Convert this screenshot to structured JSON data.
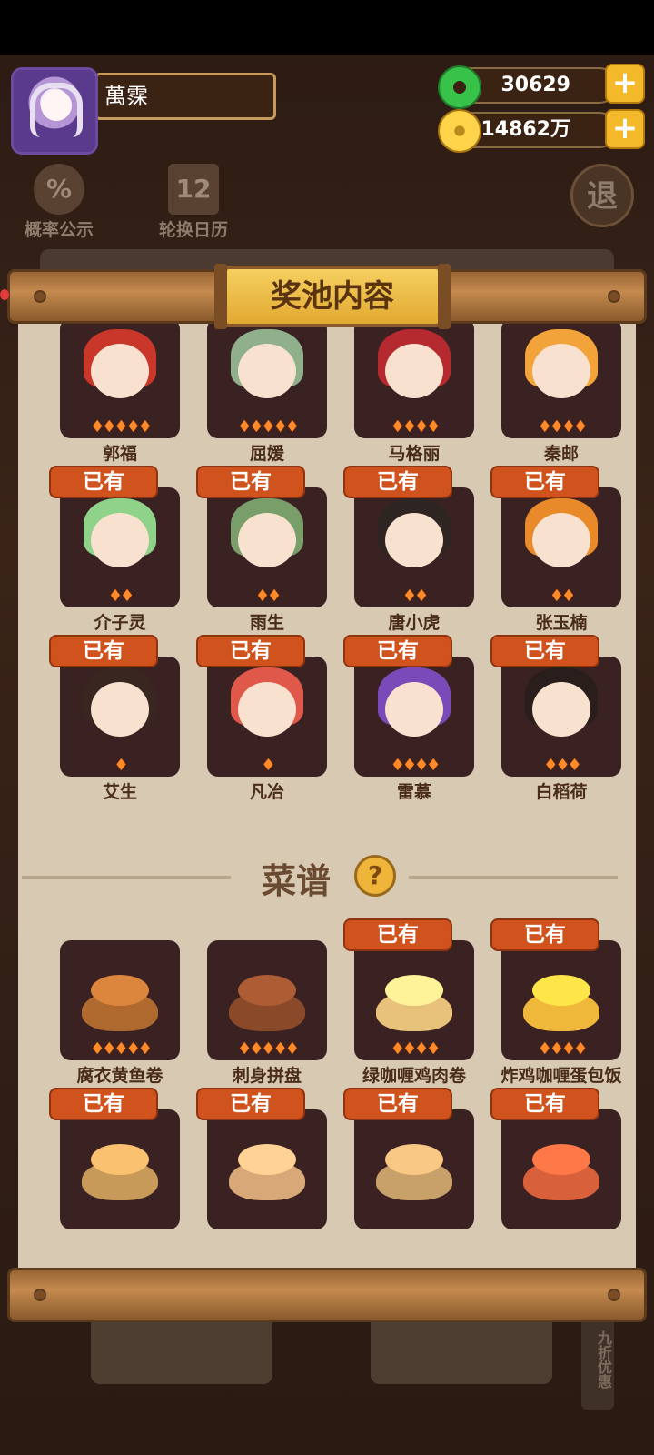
{
  "player": {
    "name": "萬霂"
  },
  "resources": {
    "jade": "30629",
    "coins": "14862万"
  },
  "background": {
    "probability_label": "概率公示",
    "calendar_label": "轮换日历",
    "exit_label": "退",
    "discount_label": "九折优惠"
  },
  "panel": {
    "title": "奖池内容"
  },
  "owned_label": "已有",
  "characters": [
    {
      "name": "郭福",
      "owned": false,
      "stars": "♦♦♦♦♦",
      "hair": "#c8372a"
    },
    {
      "name": "屈媛",
      "owned": false,
      "stars": "♦♦♦♦♦",
      "hair": "#8fb08a"
    },
    {
      "name": "马格丽",
      "owned": false,
      "stars": "♦♦♦♦",
      "hair": "#b52a2e"
    },
    {
      "name": "秦邮",
      "owned": false,
      "stars": "♦♦♦♦",
      "hair": "#f2a33a"
    },
    {
      "name": "介子灵",
      "owned": true,
      "stars": "♦♦",
      "hair": "#8fd28a"
    },
    {
      "name": "雨生",
      "owned": true,
      "stars": "♦♦",
      "hair": "#7a9e6a"
    },
    {
      "name": "唐小虎",
      "owned": true,
      "stars": "♦♦",
      "hair": "#2e2422"
    },
    {
      "name": "张玉楠",
      "owned": true,
      "stars": "♦♦",
      "hair": "#e88a2a"
    },
    {
      "name": "艾生",
      "owned": true,
      "stars": "♦",
      "hair": "#3a2620"
    },
    {
      "name": "凡冶",
      "owned": true,
      "stars": "♦",
      "hair": "#e0584a"
    },
    {
      "name": "雷慕",
      "owned": true,
      "stars": "♦♦♦♦",
      "hair": "#7a4ab8"
    },
    {
      "name": "白稻荷",
      "owned": true,
      "stars": "♦♦♦",
      "hair": "#2a1e1c"
    }
  ],
  "recipes_section": {
    "title": "菜谱",
    "help_icon": "?"
  },
  "recipes": [
    {
      "name": "腐衣黄鱼卷",
      "owned": false,
      "stars": "♦♦♦♦♦",
      "color": "#b06a30"
    },
    {
      "name": "刺身拼盘",
      "owned": false,
      "stars": "♦♦♦♦♦",
      "color": "#8a4a2a"
    },
    {
      "name": "绿咖喱鸡肉卷",
      "owned": true,
      "stars": "♦♦♦♦",
      "color": "#e8c27a"
    },
    {
      "name": "炸鸡咖喱蛋包饭",
      "owned": true,
      "stars": "♦♦♦♦",
      "color": "#f0b83a"
    },
    {
      "name": "",
      "owned": true,
      "stars": "",
      "color": "#c89a5a"
    },
    {
      "name": "",
      "owned": true,
      "stars": "",
      "color": "#d8a878"
    },
    {
      "name": "",
      "owned": true,
      "stars": "",
      "color": "#c8a06a"
    },
    {
      "name": "",
      "owned": true,
      "stars": "",
      "color": "#d8603a"
    }
  ]
}
